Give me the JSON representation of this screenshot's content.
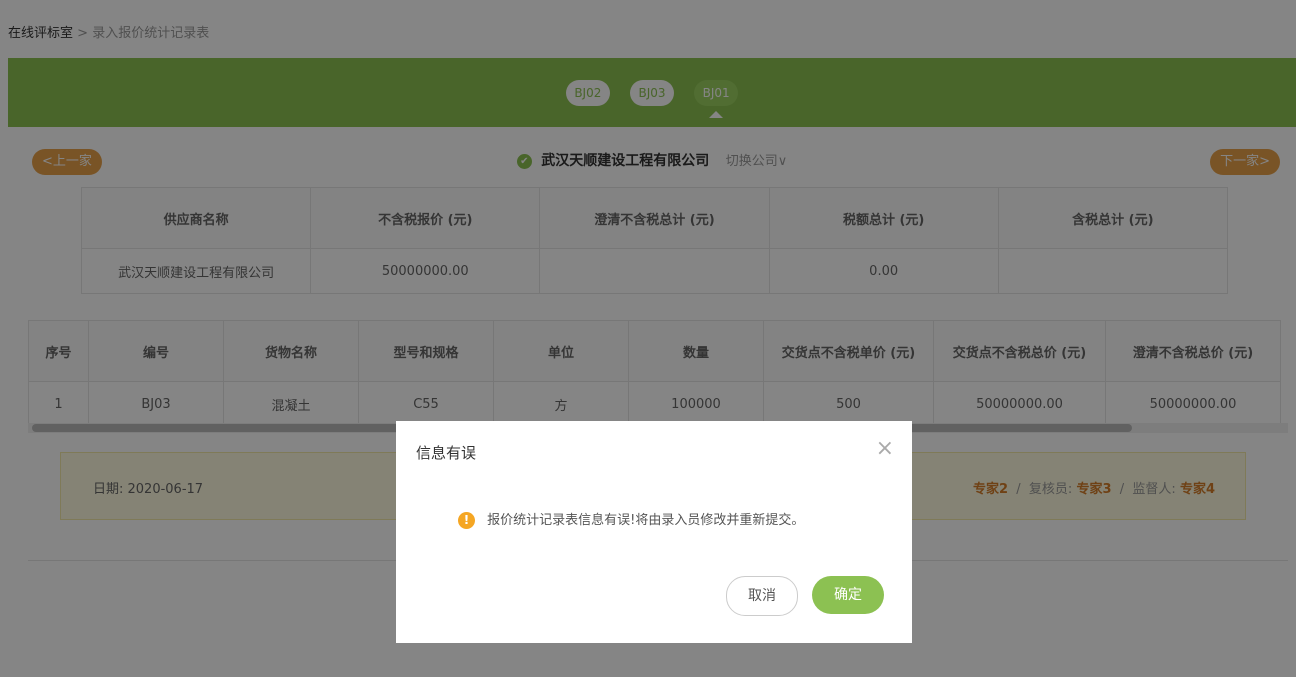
{
  "breadcrumb": {
    "home": "在线评标室",
    "sep": ">",
    "current": "录入报价统计记录表"
  },
  "tabs": [
    "BJ02",
    "BJ03",
    "BJ01"
  ],
  "nav": {
    "prev": "<上一家",
    "next": "下一家>"
  },
  "company": {
    "name": "武汉天顺建设工程有限公司",
    "switch": "切换公司∨"
  },
  "table1": {
    "headers": [
      "供应商名称",
      "不含税报价 (元)",
      "澄清不含税总计 (元)",
      "税额总计 (元)",
      "含税总计 (元)"
    ],
    "row": [
      "武汉天顺建设工程有限公司",
      "50000000.00",
      "",
      "0.00",
      ""
    ]
  },
  "table2": {
    "headers": [
      "序号",
      "编号",
      "货物名称",
      "型号和规格",
      "单位",
      "数量",
      "交货点不含税单价 (元)",
      "交货点不含税总价 (元)",
      "澄清不含税总价 (元)"
    ],
    "row": [
      "1",
      "BJ03",
      "混凝土",
      "C55",
      "方",
      "100000",
      "500",
      "50000000.00",
      "50000000.00"
    ]
  },
  "signature": {
    "date": "日期: 2020-06-17",
    "sig1": "专家2",
    "sig2_label": "复核员:",
    "sig2": "专家3",
    "sig3_label": "监督人:",
    "sig3": "专家4"
  },
  "modal": {
    "title": "信息有误",
    "message": "报价统计记录表信息有误!将由录入员修改并重新提交。",
    "cancel": "取消",
    "ok": "确定"
  }
}
